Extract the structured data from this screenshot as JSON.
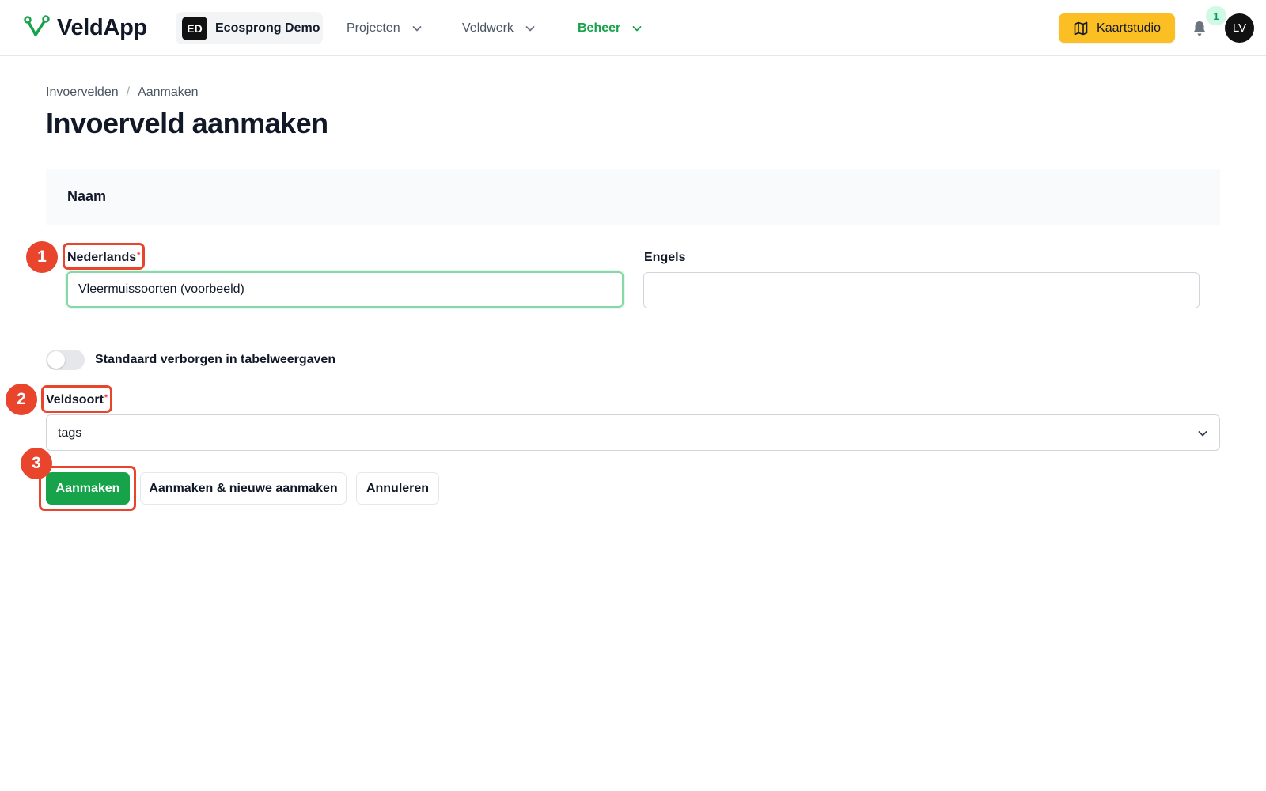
{
  "header": {
    "app_name": "VeldApp",
    "org": {
      "initials": "ED",
      "name": "Ecosprong Demo"
    },
    "nav": [
      {
        "label": "Projecten",
        "active": false
      },
      {
        "label": "Veldwerk",
        "active": false
      },
      {
        "label": "Beheer",
        "active": true
      }
    ],
    "map_button_label": "Kaartstudio",
    "notification_count": "1",
    "user_initials": "LV"
  },
  "breadcrumb": [
    "Invoervelden",
    "/",
    "Aanmaken"
  ],
  "page_title": "Invoerveld aanmaken",
  "section": {
    "title": "Naam",
    "fields": {
      "dutch": {
        "label": "Nederlands",
        "required_mark": "*",
        "value": "Vleermuissoorten (voorbeeld)",
        "placeholder": ""
      },
      "english": {
        "label": "Engels",
        "value": "",
        "placeholder": ""
      }
    }
  },
  "toggle": {
    "label": "Standaard verborgen in tabelweergaven",
    "on": false
  },
  "field_type": {
    "label": "Veldsoort",
    "required_mark": "*",
    "selected": "tags"
  },
  "actions": {
    "create": "Aanmaken",
    "create_and_new": "Aanmaken & nieuwe aanmaken",
    "cancel": "Annuleren"
  },
  "annotations": [
    "1",
    "2",
    "3"
  ],
  "colors": {
    "accent_green": "#16a34a",
    "map_button_yellow": "#fbbf24",
    "annotation_red": "#e8452c"
  },
  "icons": {
    "logo": "veldapp-logo-icon",
    "nav_chevron": "chevron-down-icon",
    "map": "map-icon",
    "notifications": "bell-icon",
    "select_chevron": "chevron-down-icon"
  }
}
